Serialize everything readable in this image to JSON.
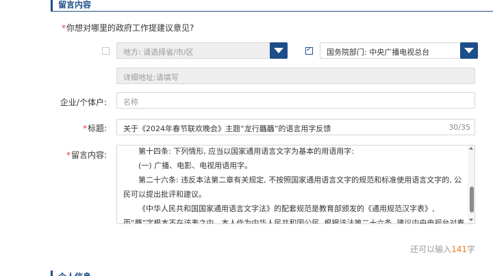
{
  "section1": {
    "title": "留言内容"
  },
  "question": {
    "required_mark": "*",
    "text": "你想对哪里的政府工作提建议意见?"
  },
  "local": {
    "select_value": "地方: 请选择省/市/区",
    "detail_placeholder": "详细地址:请填写"
  },
  "department": {
    "select_value": "国务院部门: 中央广播电视总台"
  },
  "enterprise": {
    "label": "企业/个体户:",
    "placeholder": "名称"
  },
  "title_field": {
    "required_mark": "*",
    "label": "标题:",
    "value": "关于《2024年春节联欢晚会》主题“龙行龘龘”的语言用字反馈",
    "counter": "30/35"
  },
  "message": {
    "required_mark": "*",
    "label": "留言内容:",
    "paragraphs": [
      "第十四条: 下列情形, 应当以国家通用语言文字为基本的用语用字:",
      "(一) 广播、电影、电视用语用字。",
      "第二十六条: 违反本法第二章有关规定, 不按照国家通用语言文字的规范和标准使用语言文字的, 公民可以提出批评和建议。",
      "《中华人民共和国国家通用语言文字法》的配套规范是教育部颁发的《通用规范汉字表》, 而“龘”字根本不在该表之中。本人作为中华人民共和国公民, 根据该法第二十六条, 建议中央电视台对春晚主题用字进行修改。"
    ]
  },
  "remaining": {
    "prefix": "还可以输入",
    "count": "141",
    "suffix": "字"
  },
  "section2": {
    "title": "个人信息"
  }
}
